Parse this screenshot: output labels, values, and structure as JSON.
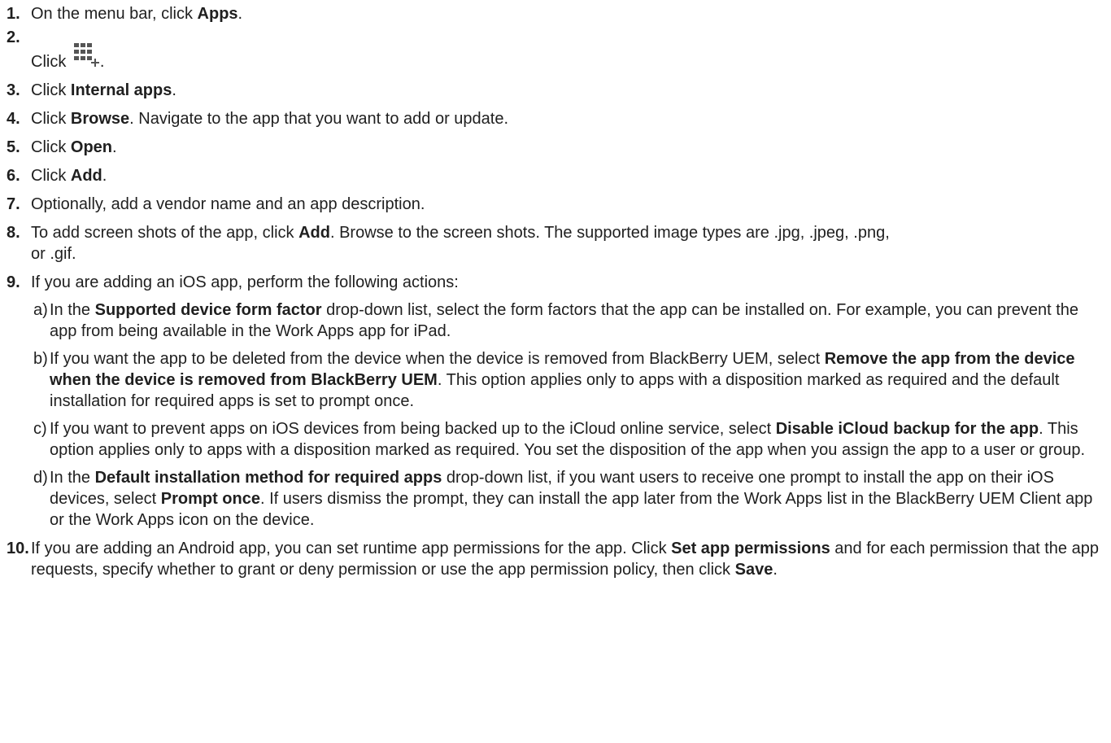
{
  "steps": [
    {
      "num": "1.",
      "pre": "On the menu bar, click ",
      "bold": "Apps",
      "post": "."
    },
    {
      "num": "2.",
      "pre": "Click ",
      "icon": "add-app-grid-icon",
      "post": "."
    },
    {
      "num": "3.",
      "pre": "Click ",
      "bold": "Internal apps",
      "post": "."
    },
    {
      "num": "4.",
      "pre": "Click ",
      "bold": "Browse",
      "post": ". Navigate to the app that you want to add or update."
    },
    {
      "num": "5.",
      "pre": "Click ",
      "bold": "Open",
      "post": "."
    },
    {
      "num": "6.",
      "pre": "Click ",
      "bold": "Add",
      "post": "."
    },
    {
      "num": "7.",
      "text": "Optionally, add a vendor name and an app description."
    },
    {
      "num": "8.",
      "pre": "To add screen shots of the app, click ",
      "bold": "Add",
      "post": ". Browse to the screen shots. The supported image types are .jpg, .jpeg, .png, or .gif."
    },
    {
      "num": "9.",
      "text": "If you are adding an iOS app, perform the following actions:"
    },
    {
      "num": "10.",
      "pre": "If you are adding an Android app, you can set runtime app permissions for the app. Click ",
      "bold": "Set app permissions",
      "mid": " and for each permission that the app requests, specify whether to grant or deny permission or use the app permission policy, then click ",
      "bold2": "Save",
      "post": "."
    }
  ],
  "substeps": [
    {
      "letter": "a)",
      "pre": "In the ",
      "bold": "Supported device form factor",
      "post": " drop-down list, select the form factors that the app can be installed on. For example, you can prevent the app from being available in the Work Apps app for iPad."
    },
    {
      "letter": "b)",
      "pre": "If you want the app to be deleted from the device when the device is removed from BlackBerry UEM, select ",
      "bold": "Remove the app from the device when the device is removed from BlackBerry UEM",
      "post": ". This option applies only to apps with a disposition marked as required and the default installation for required apps is set to prompt once."
    },
    {
      "letter": "c)",
      "pre": "If you want to prevent apps on iOS devices from being backed up to the iCloud online service, select ",
      "bold": "Disable iCloud backup for the app",
      "post": ". This option applies only to apps with a disposition marked as required. You set the disposition of the app when you assign the app to a user or group."
    },
    {
      "letter": "d)",
      "pre": "In the ",
      "bold": "Default installation method for required apps",
      "mid": " drop-down list, if you want users to receive one prompt to install the app on their iOS devices, select ",
      "bold2": "Prompt once",
      "post": ". If users dismiss the prompt, they can install the app later from the Work Apps list in the BlackBerry UEM Client app or the Work Apps icon on the device."
    }
  ]
}
